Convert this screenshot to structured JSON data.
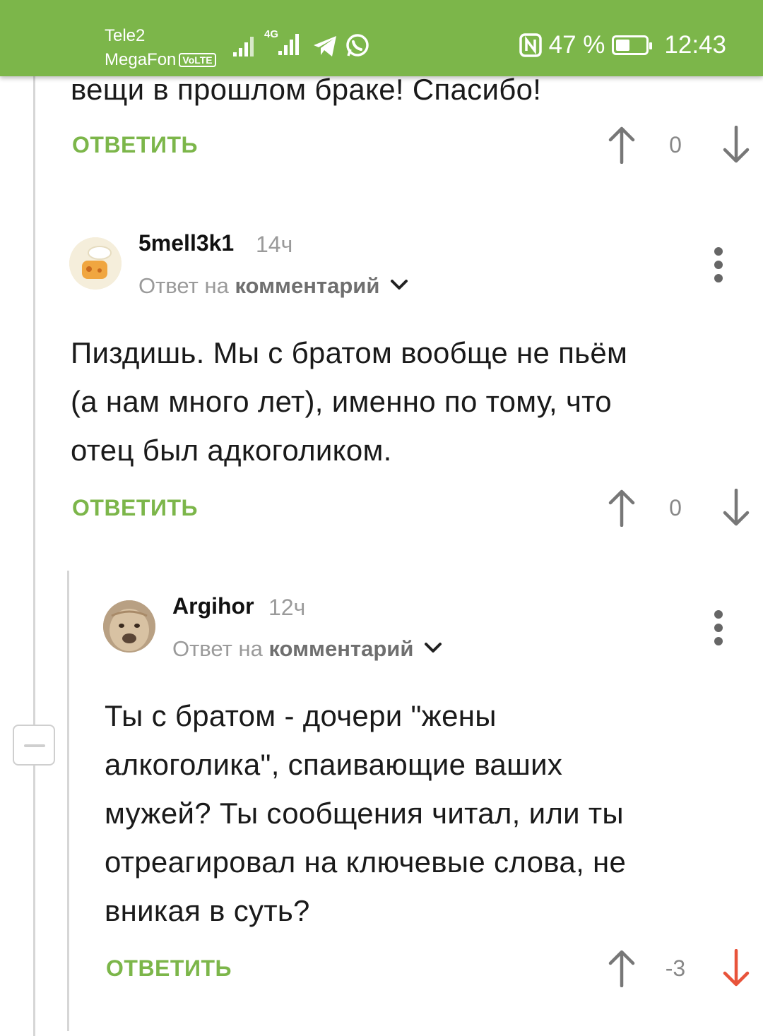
{
  "status_bar": {
    "carrier1": "Tele2",
    "carrier2": "MegaFon",
    "volte": "VoLTE",
    "network": "4G",
    "battery": "47 %",
    "battery_level": 0.47,
    "time": "12:43"
  },
  "prev_comment": {
    "text_tail": "вещи в прошлом браке! Спасибо!",
    "reply_label": "ОТВЕТИТЬ",
    "score": "0"
  },
  "comment1": {
    "author": "5mell3k1",
    "time": "14ч",
    "answer_prefix": "Ответ на",
    "answer_link": "комментарий",
    "body": [
      "Пиздишь. Мы с братом вообще не пьём",
      "(а нам много лет), именно по тому, что",
      "отец был адкоголиком."
    ],
    "reply_label": "ОТВЕТИТЬ",
    "score": "0"
  },
  "comment2": {
    "author": "Argihor",
    "time": "12ч",
    "answer_prefix": "Ответ на",
    "answer_link": "комментарий",
    "body": [
      "Ты с братом - дочери \"жены",
      "алкоголика\", спаивающие ваших",
      "мужей? Ты сообщения читал, или ты",
      "отреагировал на ключевые слова, не",
      "вникая в суть?"
    ],
    "reply_label": "ОТВЕТИТЬ",
    "score": "-3"
  },
  "colors": {
    "accent": "#7cb64a",
    "downvote_active": "#e8533a"
  }
}
